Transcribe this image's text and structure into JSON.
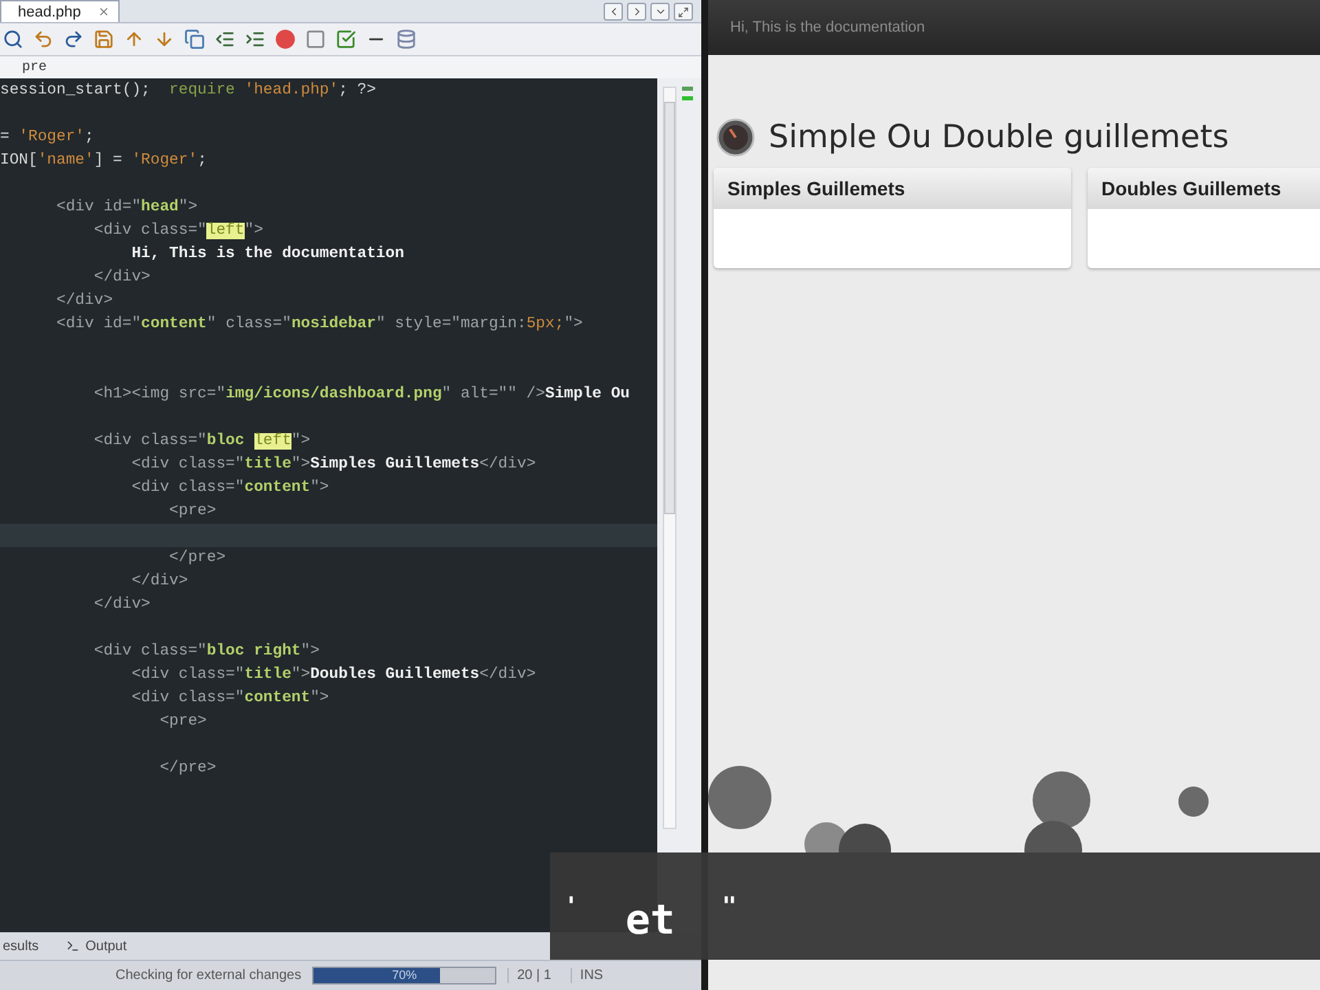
{
  "editor": {
    "tab": {
      "label": "head.php",
      "selected": true
    },
    "breadcrumb": "pre",
    "lines": [
      {
        "kind": "code",
        "tokens": [
          {
            "kind": "plain",
            "text": "session_start();  "
          },
          {
            "kind": "keyword",
            "text": "require "
          },
          {
            "kind": "string",
            "text": "'head.php'"
          },
          {
            "kind": "plain",
            "text": "; ?>"
          }
        ]
      },
      {
        "kind": "blank"
      },
      {
        "kind": "code",
        "tokens": [
          {
            "kind": "plain",
            "text": "= "
          },
          {
            "kind": "string",
            "text": "'Roger'"
          },
          {
            "kind": "plain",
            "text": ";"
          }
        ]
      },
      {
        "kind": "code",
        "tokens": [
          {
            "kind": "plain",
            "text": "ION["
          },
          {
            "kind": "string",
            "text": "'name'"
          },
          {
            "kind": "plain",
            "text": "] = "
          },
          {
            "kind": "string",
            "text": "'Roger'"
          },
          {
            "kind": "plain",
            "text": ";"
          }
        ]
      },
      {
        "kind": "blank"
      },
      {
        "kind": "code",
        "tokens": [
          {
            "kind": "tag",
            "text": "      <div id=\""
          },
          {
            "kind": "value",
            "text": "head"
          },
          {
            "kind": "tag",
            "text": "\">"
          }
        ]
      },
      {
        "kind": "code",
        "tokens": [
          {
            "kind": "tag",
            "text": "          <div class=\""
          },
          {
            "kind": "match",
            "text": "left"
          },
          {
            "kind": "tag",
            "text": "\">"
          }
        ]
      },
      {
        "kind": "code",
        "tokens": [
          {
            "kind": "text",
            "text": "              Hi, This is the documentation"
          }
        ]
      },
      {
        "kind": "code",
        "tokens": [
          {
            "kind": "tag",
            "text": "          </div>"
          }
        ]
      },
      {
        "kind": "code",
        "tokens": [
          {
            "kind": "tag",
            "text": "      </div>"
          }
        ]
      },
      {
        "kind": "code",
        "tokens": [
          {
            "kind": "tag",
            "text": "      <div id=\""
          },
          {
            "kind": "value",
            "text": "content"
          },
          {
            "kind": "tag",
            "text": "\" class=\""
          },
          {
            "kind": "value",
            "text": "nosidebar"
          },
          {
            "kind": "tag",
            "text": "\" style=\"margin:"
          },
          {
            "kind": "string",
            "text": "5px;"
          },
          {
            "kind": "tag",
            "text": "\">"
          }
        ]
      },
      {
        "kind": "blank"
      },
      {
        "kind": "blank"
      },
      {
        "kind": "code",
        "tokens": [
          {
            "kind": "tag",
            "text": "          <h1><img src=\""
          },
          {
            "kind": "value",
            "text": "img/icons/dashboard.png"
          },
          {
            "kind": "tag",
            "text": "\" alt=\"\" />"
          },
          {
            "kind": "text",
            "text": "Simple Ou"
          }
        ]
      },
      {
        "kind": "blank"
      },
      {
        "kind": "code",
        "tokens": [
          {
            "kind": "tag",
            "text": "          <div class=\""
          },
          {
            "kind": "value",
            "text": "bloc "
          },
          {
            "kind": "match",
            "text": "left"
          },
          {
            "kind": "tag",
            "text": "\">"
          }
        ]
      },
      {
        "kind": "code",
        "tokens": [
          {
            "kind": "tag",
            "text": "              <div class=\""
          },
          {
            "kind": "value",
            "text": "title"
          },
          {
            "kind": "tag",
            "text": "\">"
          },
          {
            "kind": "text",
            "text": "Simples Guillemets"
          },
          {
            "kind": "tag",
            "text": "</div>"
          }
        ]
      },
      {
        "kind": "code",
        "tokens": [
          {
            "kind": "tag",
            "text": "              <div class=\""
          },
          {
            "kind": "value",
            "text": "content"
          },
          {
            "kind": "tag",
            "text": "\">"
          }
        ]
      },
      {
        "kind": "code",
        "tokens": [
          {
            "kind": "tag",
            "text": "                  <pre>"
          }
        ]
      },
      {
        "kind": "current"
      },
      {
        "kind": "code",
        "tokens": [
          {
            "kind": "tag",
            "text": "                  </pre>"
          }
        ]
      },
      {
        "kind": "code",
        "tokens": [
          {
            "kind": "tag",
            "text": "              </div>"
          }
        ]
      },
      {
        "kind": "code",
        "tokens": [
          {
            "kind": "tag",
            "text": "          </div>"
          }
        ]
      },
      {
        "kind": "blank"
      },
      {
        "kind": "code",
        "tokens": [
          {
            "kind": "tag",
            "text": "          <div class=\""
          },
          {
            "kind": "value",
            "text": "bloc right"
          },
          {
            "kind": "tag",
            "text": "\">"
          }
        ]
      },
      {
        "kind": "code",
        "tokens": [
          {
            "kind": "tag",
            "text": "              <div class=\""
          },
          {
            "kind": "value",
            "text": "title"
          },
          {
            "kind": "tag",
            "text": "\">"
          },
          {
            "kind": "text",
            "text": "Doubles Guillemets"
          },
          {
            "kind": "tag",
            "text": "</div>"
          }
        ]
      },
      {
        "kind": "code",
        "tokens": [
          {
            "kind": "tag",
            "text": "              <div class=\""
          },
          {
            "kind": "value",
            "text": "content"
          },
          {
            "kind": "tag",
            "text": "\">"
          }
        ]
      },
      {
        "kind": "code",
        "tokens": [
          {
            "kind": "tag",
            "text": "                 <pre>"
          }
        ]
      },
      {
        "kind": "blank"
      },
      {
        "kind": "code",
        "tokens": [
          {
            "kind": "tag",
            "text": "                 </pre>"
          }
        ]
      }
    ],
    "bottom_tabs": [
      {
        "label": "esults",
        "selected": false
      },
      {
        "label": "Output",
        "selected": false
      }
    ],
    "status": {
      "message": "Checking for external changes",
      "progress": {
        "level": 0.7,
        "reading": "70%"
      },
      "position": "20 | 1",
      "mode": "INS"
    }
  },
  "browser": {
    "header_text": "Hi, This is the documentation",
    "heading": "Simple Ou Double guillemets",
    "cards": [
      {
        "title": "Simples Guillemets"
      },
      {
        "title": "Doubles Guillemets"
      }
    ]
  },
  "caption": [
    "'",
    "et",
    "\""
  ]
}
